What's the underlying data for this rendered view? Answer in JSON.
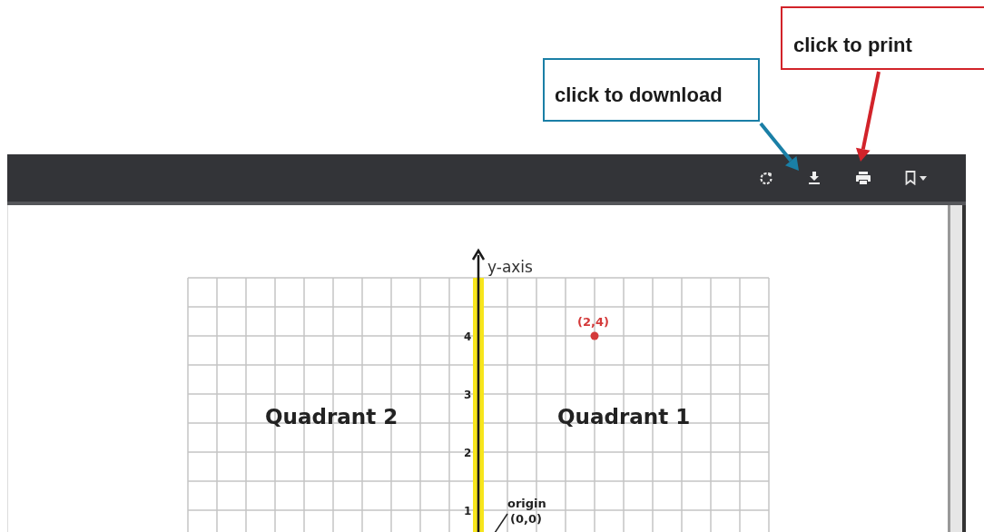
{
  "callouts": [
    {
      "text": "click to print",
      "color": "#d2232a",
      "kind": "print"
    },
    {
      "text": "click to download",
      "color": "#1a7fa6",
      "kind": "download"
    }
  ],
  "toolbar": {
    "buttons": [
      {
        "kind": "rotate"
      },
      {
        "kind": "download"
      },
      {
        "kind": "print"
      },
      {
        "kind": "bookmark"
      }
    ]
  },
  "graph": {
    "axis_label": "y-axis",
    "quadrants": [
      "Quadrant 2",
      "Quadrant 1"
    ],
    "y_ticks": [
      "4",
      "3",
      "2",
      "1"
    ],
    "point_label": "(2,4)",
    "origin_label": "origin",
    "origin_coords": "(0,0)"
  }
}
